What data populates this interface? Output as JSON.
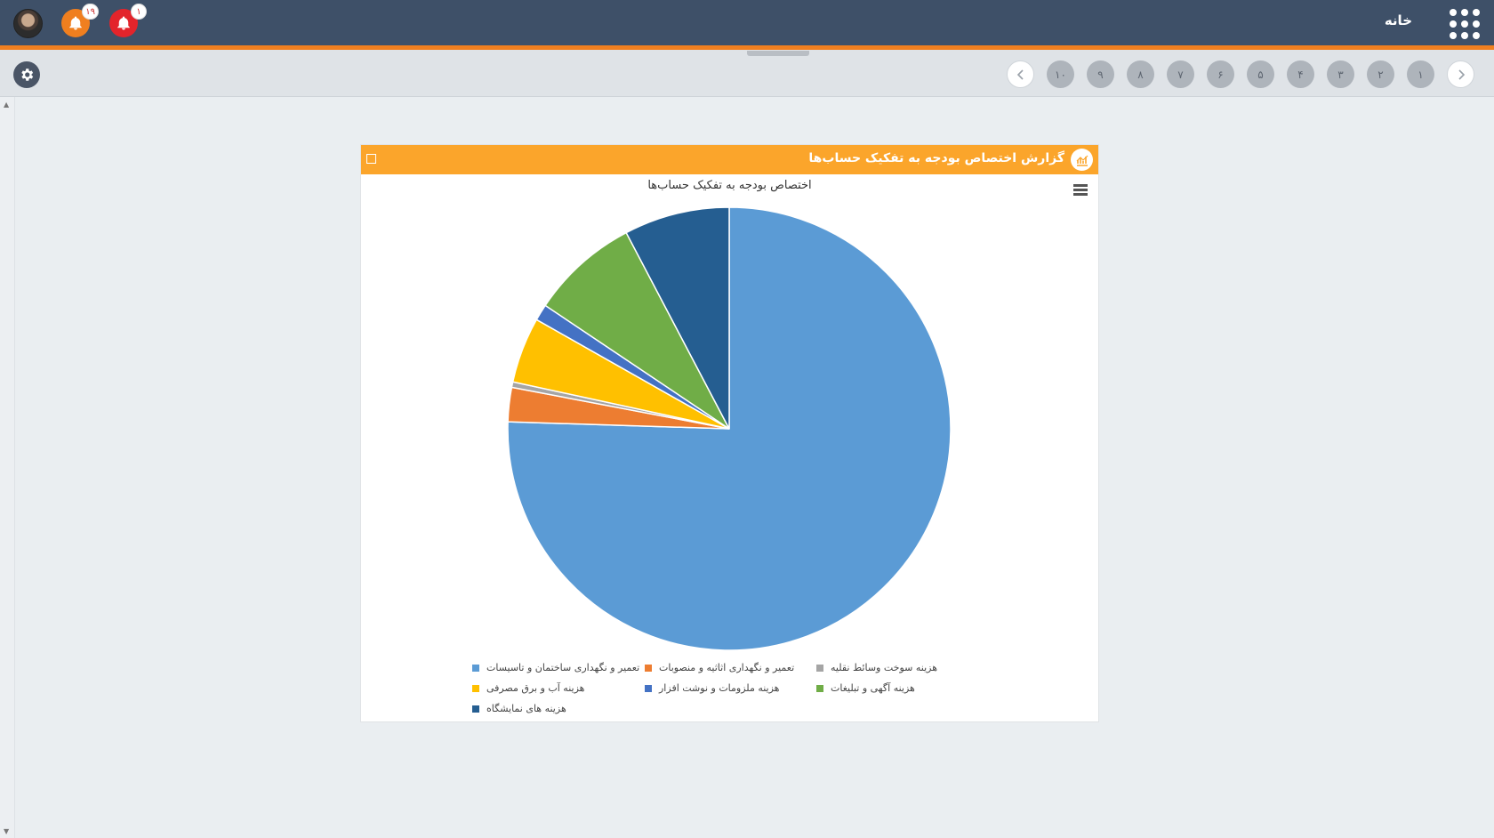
{
  "topbar": {
    "home_label": "خانه",
    "notifications": [
      {
        "badge": "۱۹",
        "color": "#f07f1f"
      },
      {
        "badge": "۱",
        "color": "#e3242b"
      }
    ]
  },
  "pager": {
    "pages": [
      "۱",
      "۲",
      "۳",
      "۴",
      "۵",
      "۶",
      "۷",
      "۸",
      "۹",
      "۱۰"
    ]
  },
  "panel": {
    "title": "گزارش اختصاص بودجه به تفکیک حساب‌ها",
    "accent": "#fba52b"
  },
  "chart_data": {
    "type": "pie",
    "title": "اختصاص بودجه به تفکیک حساب‌ها",
    "slices": [
      {
        "label": "تعمیر و نگهداری ساختمان و تاسیسات",
        "value": 75.5,
        "color": "#5b9bd5"
      },
      {
        "label": "تعمیر و نگهداری اثاثیه و منصوبات",
        "value": 2.5,
        "color": "#ed7d31"
      },
      {
        "label": "هزینه سوخت وسائط نقلیه",
        "value": 0.4,
        "color": "#a5a5a5"
      },
      {
        "label": "هزینه آب و برق مصرفی",
        "value": 4.8,
        "color": "#ffc000"
      },
      {
        "label": "هزینه ملزومات و نوشت افزار",
        "value": 1.2,
        "color": "#4472c4"
      },
      {
        "label": "هزینه آگهی و تبلیغات",
        "value": 7.9,
        "color": "#70ad47"
      },
      {
        "label": "هزینه های نمایشگاه",
        "value": 7.7,
        "color": "#255e91"
      }
    ],
    "legend_position": "bottom"
  }
}
